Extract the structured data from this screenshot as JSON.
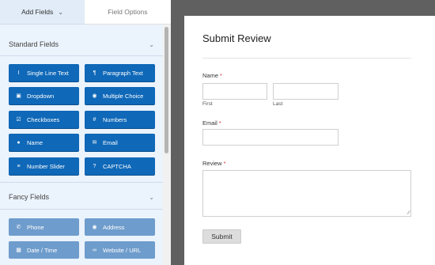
{
  "tabs": {
    "add_fields": "Add Fields",
    "field_options": "Field Options"
  },
  "sections": {
    "standard": "Standard Fields",
    "fancy": "Fancy Fields"
  },
  "standard_fields": [
    {
      "label": "Single Line Text",
      "icon": "text-cursor-icon"
    },
    {
      "label": "Paragraph Text",
      "icon": "paragraph-icon"
    },
    {
      "label": "Dropdown",
      "icon": "dropdown-icon"
    },
    {
      "label": "Multiple Choice",
      "icon": "radio-icon"
    },
    {
      "label": "Checkboxes",
      "icon": "checkbox-icon"
    },
    {
      "label": "Numbers",
      "icon": "hash-icon"
    },
    {
      "label": "Name",
      "icon": "user-icon"
    },
    {
      "label": "Email",
      "icon": "envelope-icon"
    },
    {
      "label": "Number Slider",
      "icon": "sliders-icon"
    },
    {
      "label": "CAPTCHA",
      "icon": "question-circle-icon"
    }
  ],
  "fancy_fields": [
    {
      "label": "Phone",
      "icon": "phone-icon"
    },
    {
      "label": "Address",
      "icon": "map-marker-icon"
    },
    {
      "label": "Date / Time",
      "icon": "calendar-icon"
    },
    {
      "label": "Website / URL",
      "icon": "link-icon"
    }
  ],
  "form": {
    "title": "Submit Review",
    "name_label": "Name",
    "first_sublabel": "First",
    "last_sublabel": "Last",
    "email_label": "Email",
    "review_label": "Review",
    "required_marker": "*",
    "submit_label": "Submit"
  },
  "colors": {
    "standard_button": "#0f68b8",
    "fancy_button": "#6e9ccc",
    "panel_bg": "#ebf3fc",
    "required": "#d63638",
    "canvas_bg": "#606060"
  }
}
